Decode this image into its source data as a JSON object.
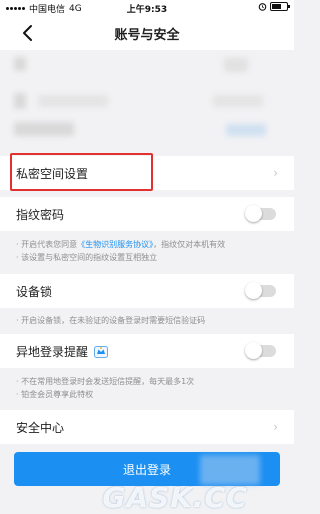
{
  "status_bar": {
    "carrier": "中国电信",
    "network": "4G",
    "time": "上午9:53"
  },
  "header": {
    "title": "账号与安全"
  },
  "rows": {
    "private_space": "私密空间设置",
    "fingerprint": "指纹密码",
    "device_lock": "设备锁",
    "remote_login": "异地登录提醒",
    "security_center": "安全中心"
  },
  "notes": {
    "fingerprint_1_prefix": "· 开启代表您同意",
    "fingerprint_1_link": "《生物识别服务协议》",
    "fingerprint_1_suffix": "，指纹仅对本机有效",
    "fingerprint_2": "· 该设置与私密空间的指纹设置互相独立",
    "device_lock_1": "· 开启设备锁，在未验证的设备登录时需要短信验证码",
    "remote_login_1": "· 不在常用地登录时会发送短信提醒，每天最多1次",
    "remote_login_2": "· 铂金会员尊享此特权"
  },
  "logout_label": "退出登录",
  "watermark": "GASK.CC",
  "colors": {
    "accent": "#1b8ff2",
    "highlight_box": "#e53030",
    "link": "#1b8ff2"
  }
}
